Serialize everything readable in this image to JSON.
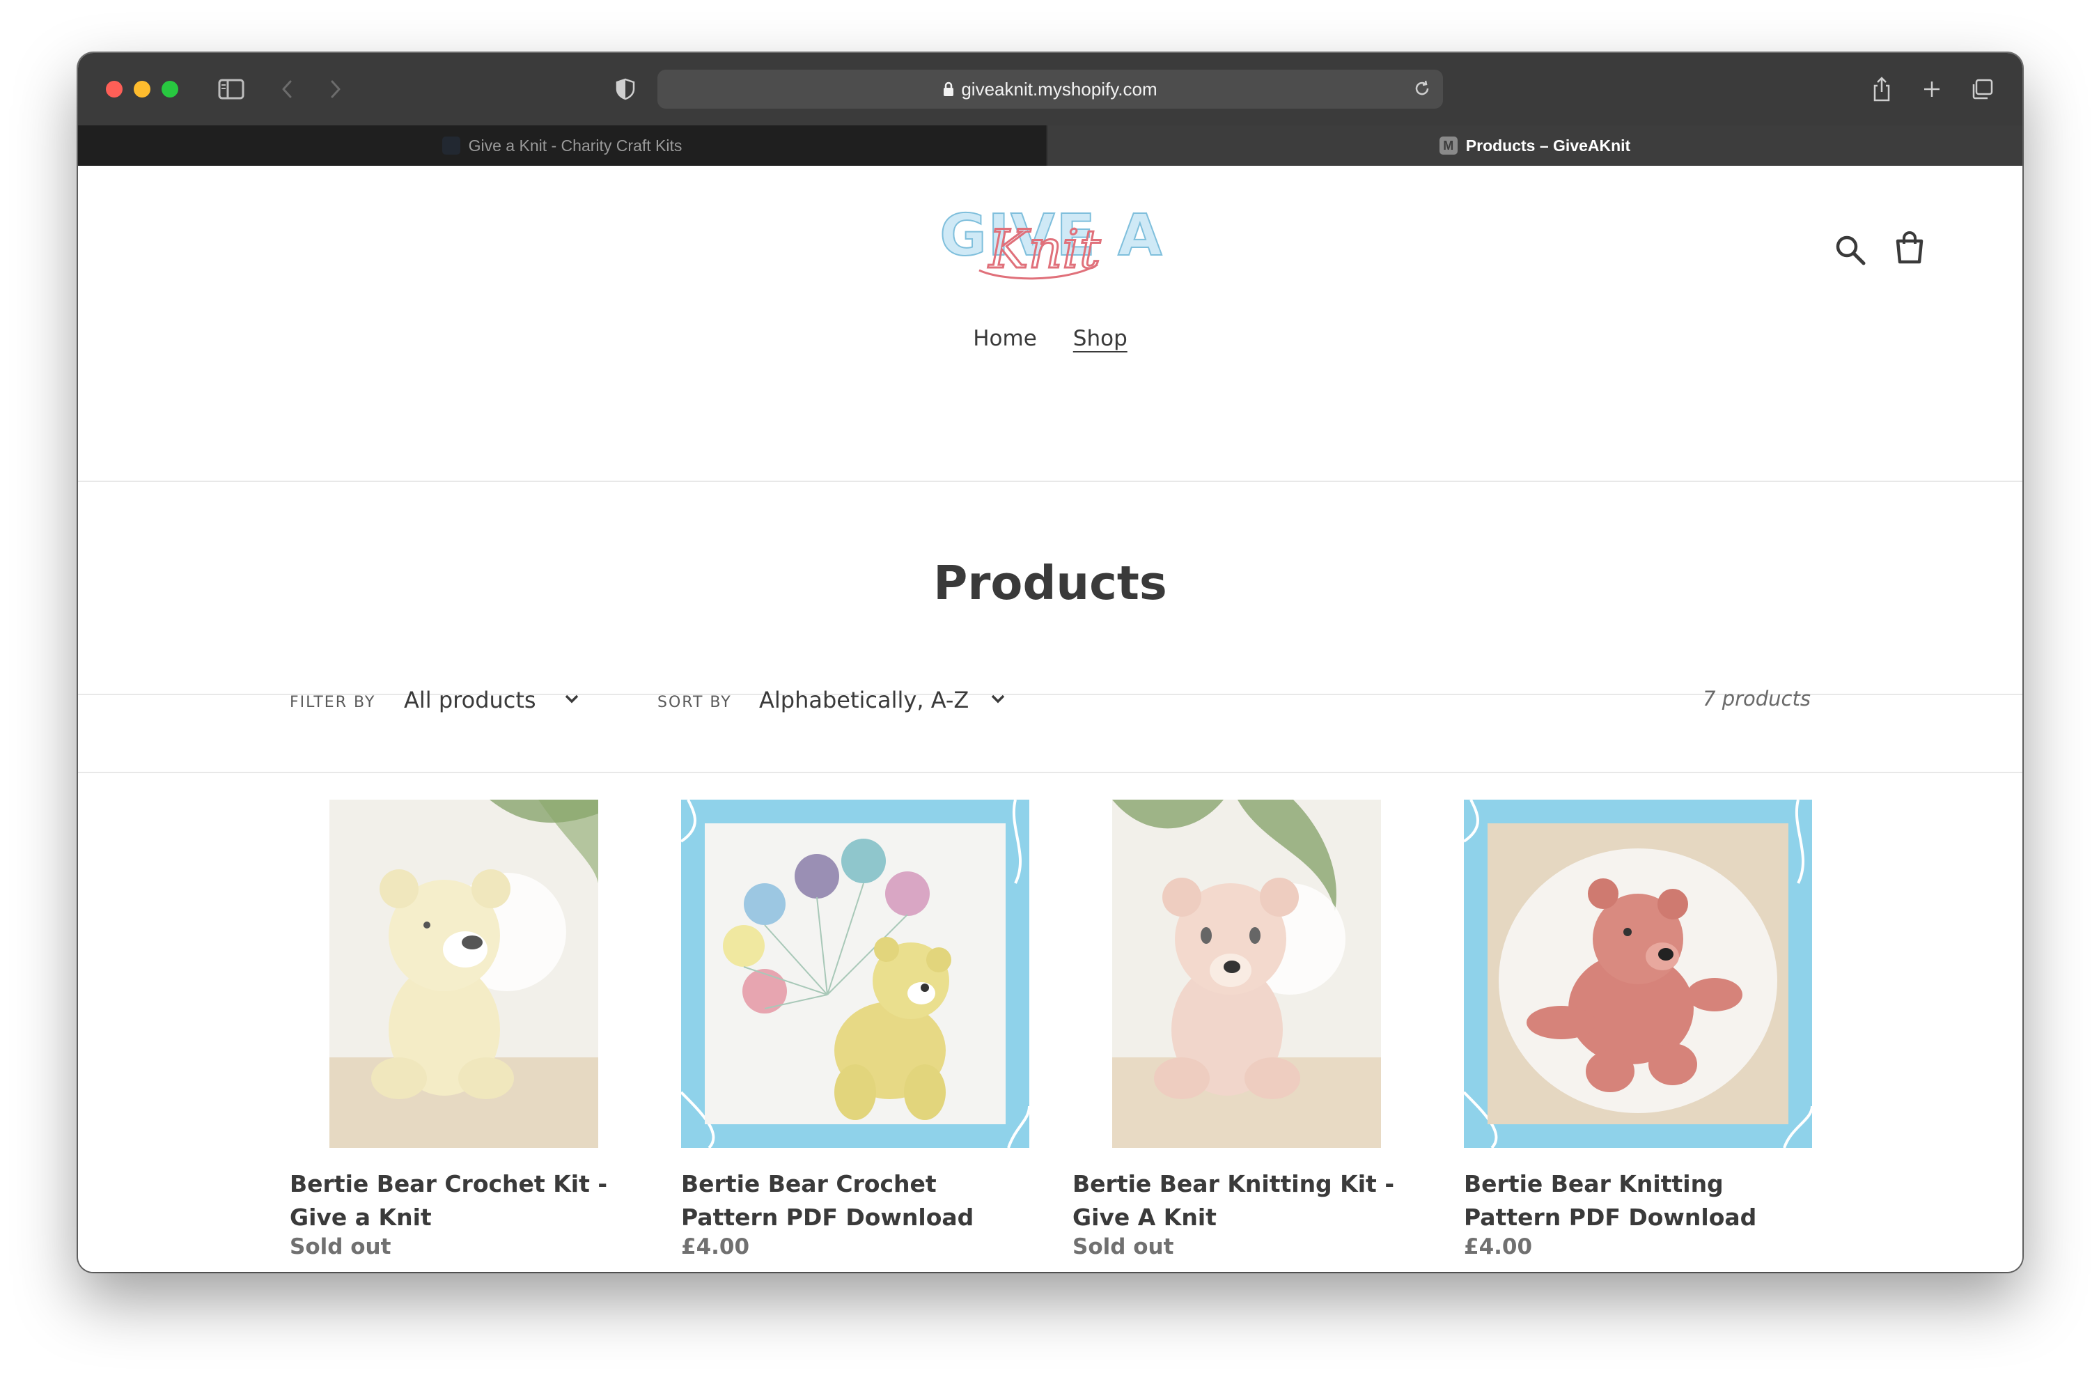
{
  "browser": {
    "url": "giveaknit.myshopify.com",
    "tabs": [
      {
        "title": "Give a Knit - Charity Craft Kits",
        "active": false
      },
      {
        "title": "Products – GiveAKnit",
        "active": true,
        "favicon_letter": "M"
      }
    ]
  },
  "site": {
    "logo_text": {
      "top": "GIVE A",
      "script": "Knit"
    },
    "nav": [
      {
        "label": "Home",
        "active": false
      },
      {
        "label": "Shop",
        "active": true
      }
    ],
    "icons": [
      "search-icon",
      "cart-icon"
    ]
  },
  "collection": {
    "title": "Products",
    "filter_label": "FILTER BY",
    "filter_value": "All products",
    "sort_label": "SORT BY",
    "sort_value": "Alphabetically, A-Z",
    "count_text": "7 products"
  },
  "products": [
    {
      "name": "Bertie Bear Crochet Kit - Give a Knit",
      "price": "Sold out",
      "image": "cream crocheted teddy bear in front of a plant"
    },
    {
      "name": "Bertie Bear Crochet Pattern PDF Download",
      "price": "£4.00",
      "image": "yellow crocheted bear holding yarn balloons on blue frame"
    },
    {
      "name": "Bertie Bear Knitting Kit - Give A Knit",
      "price": "Sold out",
      "image": "pale pink knitted teddy bear in front of a plant"
    },
    {
      "name": "Bertie Bear Knitting Pattern PDF Download",
      "price": "£4.00",
      "image": "pink knitted bear on white fur rug on blue frame"
    }
  ],
  "colors": {
    "chrome": "#3b3b3b",
    "text": "#3a3a3a",
    "frame_blue": "#8fd2ea",
    "logo_blue": "#a8d8ee",
    "logo_pink": "#e0707a"
  }
}
